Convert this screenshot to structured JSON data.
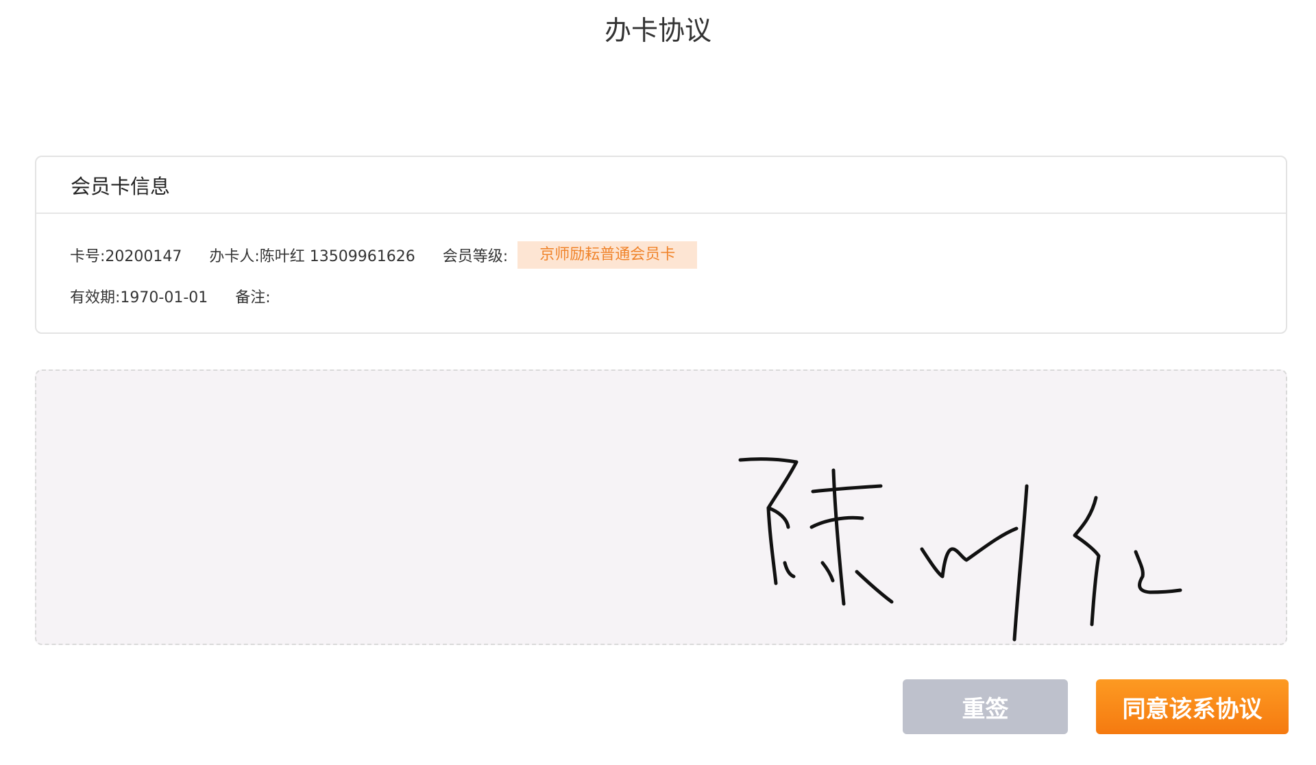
{
  "page": {
    "title": "办卡协议"
  },
  "card": {
    "title": "会员卡信息",
    "card_no": "卡号:20200147",
    "holder": "办卡人:陈叶红 13509961626",
    "level_label": "会员等级:",
    "level_value": "京师励耘普通会员卡",
    "validity": "有效期:1970-01-01",
    "remark": "备注:"
  },
  "signature": {
    "text": "陈叶红"
  },
  "buttons": {
    "reset_label": "重签",
    "agree_label": "同意该系协议"
  },
  "colors": {
    "accent": "#f57a10",
    "badge_bg": "#fde5d3",
    "badge_text": "#f0832a",
    "reset_bg": "#bec1cc",
    "sign_bg": "#f6f3f6"
  }
}
